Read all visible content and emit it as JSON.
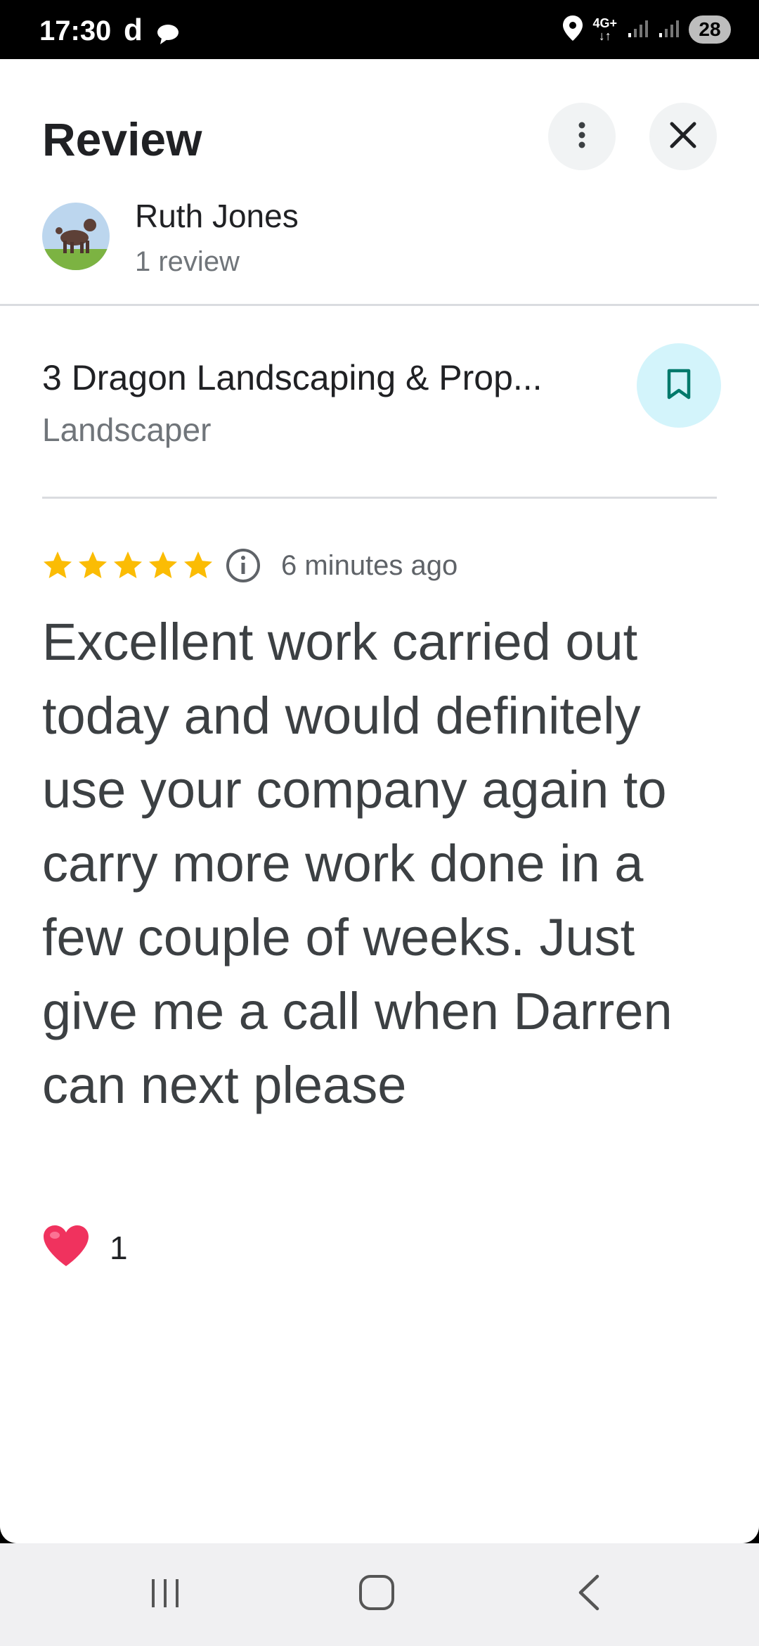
{
  "status": {
    "time": "17:30",
    "app_letter": "d",
    "network_top": "4G+",
    "network_bottom": "↓↑",
    "battery": "28"
  },
  "header": {
    "title": "Review"
  },
  "author": {
    "name": "Ruth Jones",
    "review_count": "1 review"
  },
  "place": {
    "name": "3 Dragon Landscaping & Prop...",
    "category": "Landscaper"
  },
  "review": {
    "stars": 5,
    "star_color": "#fbbc04",
    "time": "6 minutes ago",
    "text": "Excellent work carried out today and would definitely use your company again to carry more work done in a few couple of weeks. Just give me a call when Darren can next please"
  },
  "reactions": {
    "like_count": "1"
  },
  "icons": {
    "more": "more-vert-icon",
    "close": "close-icon",
    "save": "bookmark-icon",
    "info": "info-icon",
    "heart": "heart-icon"
  }
}
